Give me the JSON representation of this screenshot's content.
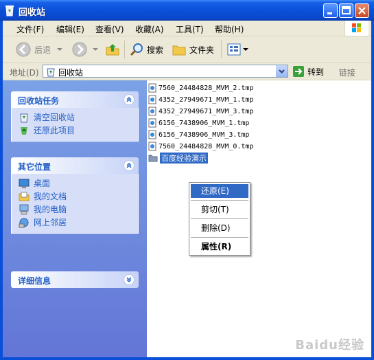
{
  "window": {
    "title": "回收站"
  },
  "menubar": {
    "items": [
      "文件(F)",
      "编辑(E)",
      "查看(V)",
      "收藏(A)",
      "工具(T)",
      "帮助(H)"
    ]
  },
  "toolbar": {
    "back": "后退",
    "search": "搜索",
    "folders": "文件夹"
  },
  "address": {
    "label": "地址(D)",
    "value": "回收站",
    "go": "转到",
    "links": "链接"
  },
  "tasks_panel": {
    "title": "回收站任务",
    "items": [
      "清空回收站",
      "还原此项目"
    ]
  },
  "places_panel": {
    "title": "其它位置",
    "items": [
      "桌面",
      "我的文档",
      "我的电脑",
      "网上邻居"
    ]
  },
  "details_panel": {
    "title": "详细信息"
  },
  "files": [
    "7560_24484828_MVM_2.tmp",
    "4352_27949671_MVM_1.tmp",
    "4352_27949671_MVM_3.tmp",
    "6156_7438906_MVM_1.tmp",
    "6156_7438906_MVM_3.tmp",
    "7560_24484828_MVM_0.tmp"
  ],
  "selected_folder": "百度经验演示",
  "context_menu": {
    "restore": "还原(E)",
    "cut": "剪切(T)",
    "delete": "删除(D)",
    "properties": "属性(R)"
  },
  "watermark": "Baidu经验",
  "colors": {
    "title_blue": "#0a50d8",
    "task_blue": "#215dc6",
    "selection": "#316ac5"
  }
}
